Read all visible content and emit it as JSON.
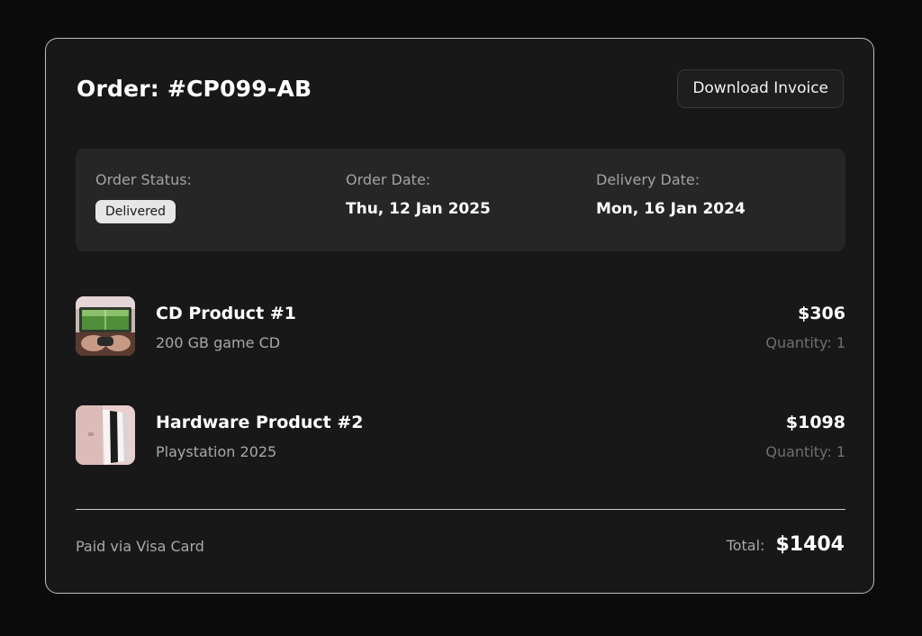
{
  "order": {
    "title": "Order: #CP099-AB",
    "download_label": "Download Invoice"
  },
  "status": {
    "status_label": "Order Status:",
    "status_value": "Delivered",
    "order_date_label": "Order Date:",
    "order_date_value": "Thu, 12 Jan 2025",
    "delivery_date_label": "Delivery Date:",
    "delivery_date_value": "Mon, 16 Jan 2024"
  },
  "items": [
    {
      "name": "CD Product #1",
      "description": "200 GB game CD",
      "price": "$306",
      "quantity": "Quantity: 1",
      "thumbnail_icon": "game-cd-photo"
    },
    {
      "name": "Hardware Product #2",
      "description": "Playstation 2025",
      "price": "$1098",
      "quantity": "Quantity: 1",
      "thumbnail_icon": "console-photo"
    }
  ],
  "footer": {
    "payment": "Paid via Visa Card",
    "total_label": "Total:",
    "total_value": "$1404"
  }
}
